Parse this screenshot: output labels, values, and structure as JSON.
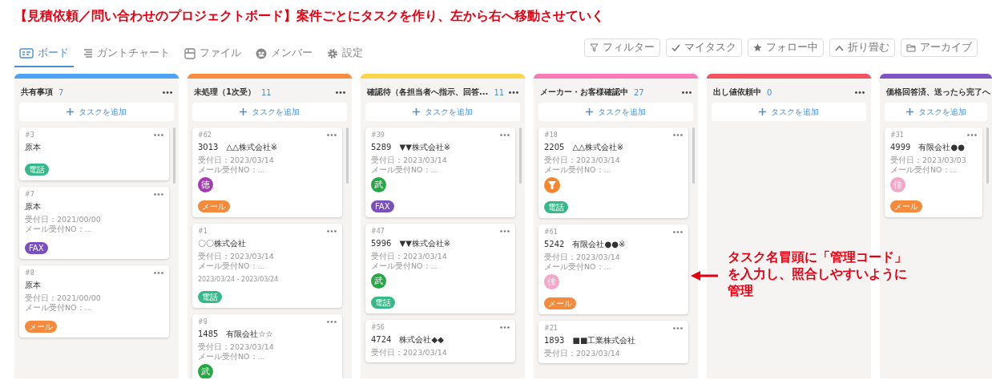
{
  "headline": "【見積依頼／問い合わせのプロジェクトボード】案件ごとにタスクを作り、左から右へ移動させていく",
  "tabs": [
    {
      "label": "ボード",
      "kind": "board",
      "selected": true
    },
    {
      "label": "ガントチャート",
      "kind": "gantt",
      "selected": false
    },
    {
      "label": "ファイル",
      "kind": "file",
      "selected": false
    },
    {
      "label": "メンバー",
      "kind": "member",
      "selected": false
    },
    {
      "label": "設定",
      "kind": "settings",
      "selected": false
    }
  ],
  "tools": [
    {
      "label": "フィルター",
      "kind": "filter"
    },
    {
      "label": "マイタスク",
      "kind": "check"
    },
    {
      "label": "フォロー中",
      "kind": "star"
    },
    {
      "label": "折り畳む",
      "kind": "collapse"
    },
    {
      "label": "アーカイブ",
      "kind": "archive"
    }
  ],
  "columns": [
    {
      "title": "共有事項",
      "count": "7",
      "color": "#4da3f5",
      "add": "タスクを追加",
      "cards": [
        {
          "number": "#3",
          "title": "原本",
          "tag": {
            "label": "電話",
            "color": "#35b98a"
          }
        },
        {
          "number": "#7",
          "title": "原本",
          "lines": [
            "受付日：2021/00/00",
            "メール受付NO：..."
          ],
          "tag": {
            "label": "FAX",
            "color": "#7a4fc0"
          }
        },
        {
          "number": "#8",
          "title": "原本",
          "lines": [
            "受付日：2021/00/00",
            "メール受付NO：..."
          ],
          "tag": {
            "label": "メール",
            "color": "#f58a3c"
          }
        }
      ]
    },
    {
      "title": "未処理（1次受）",
      "count": "11",
      "color": "#f98d3f",
      "add": "タスクを追加",
      "cards": [
        {
          "number": "#62",
          "title": "3013　△△株式会社※",
          "lines": [
            "受付日：2023/03/14",
            "メール受付NO：..."
          ],
          "avatar": {
            "kind": "letter",
            "text": "徳",
            "color": "#a43bb5"
          },
          "tag": {
            "label": "メール",
            "color": "#f58a3c"
          }
        },
        {
          "number": "#1",
          "title": "〇〇株式会社",
          "lines": [
            "受付日：2023/03/14",
            "メール受付NO：..."
          ],
          "period": "2023/03/24 - 2023/03/24",
          "tag": {
            "label": "電話",
            "color": "#35b98a"
          }
        },
        {
          "number": "#9",
          "title": "1485　有限会社☆☆",
          "lines": [
            "受付日：2023/03/14",
            "メール受付NO：..."
          ],
          "avatar": {
            "kind": "letter",
            "text": "武",
            "color": "#27a745"
          }
        }
      ]
    },
    {
      "title": "確認待（各担当者へ指示、回答...",
      "count": "11",
      "color": "#fbd54a",
      "add": "タスクを追加",
      "cards": [
        {
          "number": "#39",
          "title": "5289　▼▼株式会社※",
          "lines": [
            "受付日：2023/03/14",
            "メール受付NO：..."
          ],
          "avatar": {
            "kind": "letter",
            "text": "武",
            "color": "#27a745"
          },
          "tag": {
            "label": "FAX",
            "color": "#7a4fc0"
          }
        },
        {
          "number": "#47",
          "title": "5996　▼▼株式会社※",
          "lines": [
            "受付日：2023/03/14",
            "メール受付NO：..."
          ],
          "avatar": {
            "kind": "letter",
            "text": "武",
            "color": "#27a745"
          },
          "tag": {
            "label": "電話",
            "color": "#35b98a"
          }
        },
        {
          "number": "#56",
          "title": "4724　株式会社◆◆",
          "lines": [
            "受付日：2023/03/14"
          ]
        }
      ]
    },
    {
      "title": "メーカー・お客様確認中",
      "count": "27",
      "color": "#f97cb6",
      "add": "タスクを追加",
      "cards": [
        {
          "number": "#18",
          "title": "2205　△△株式会社※",
          "lines": [
            "受付日：2023/03/14",
            "メール受付NO：..."
          ],
          "avatar": {
            "kind": "icon",
            "color": "#f5862e"
          },
          "tag": {
            "label": "電話",
            "color": "#35b98a"
          }
        },
        {
          "number": "#61",
          "title": "5242　有限会社●●※",
          "lines": [
            "受付日：2023/03/14",
            "メール受付NO：..."
          ],
          "avatar": {
            "kind": "letter",
            "text": "佳",
            "color": "#f6a6c9"
          },
          "tag": {
            "label": "メール",
            "color": "#f58a3c"
          }
        },
        {
          "number": "#21",
          "title": "1893　■■工業株式会社",
          "lines": [
            "受付日：2023/03/14"
          ]
        }
      ]
    },
    {
      "title": "出し値依頼中",
      "count": "0",
      "color": "#f4525f",
      "add": "タスクを追加"
    },
    {
      "title": "価格回答済、送ったら完了へ",
      "color": "#7f55c6",
      "add": "タスクを追加",
      "cards": [
        {
          "number": "#31",
          "title": "4999　有限会社●●",
          "lines": [
            "受付日：2023/03/03",
            "メール受付NO：..."
          ],
          "avatar": {
            "kind": "letter",
            "text": "佳",
            "color": "#f6a6c9"
          },
          "tag": {
            "label": "メール",
            "color": "#f58a3c"
          }
        }
      ]
    }
  ],
  "note": "タスク名冒頭に「管理コード」を入力し、照合しやすいように管理"
}
